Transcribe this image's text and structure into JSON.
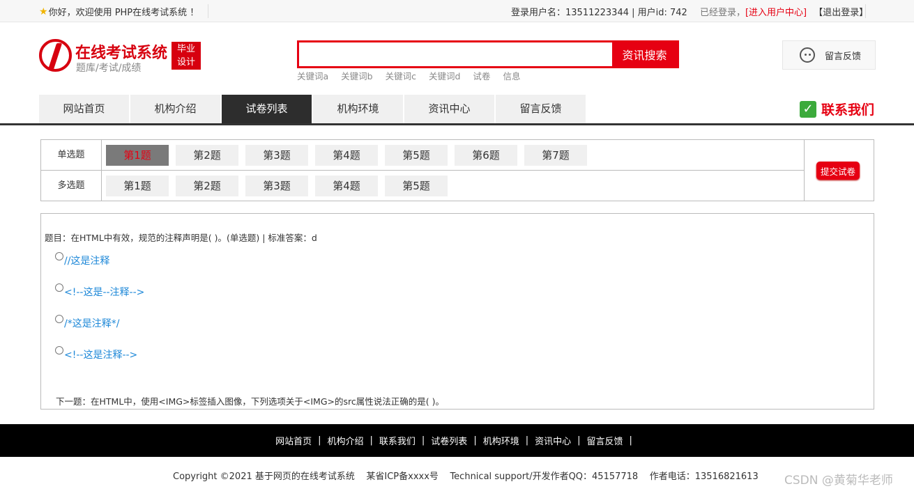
{
  "topbar": {
    "welcome": "你好，欢迎使用 PHP在线考试系统 ！",
    "user_label": "登录用户名：13511223344 | 用户id: 742",
    "status": "已经登录，",
    "user_center": "[进入用户中心]",
    "logout": "【退出登录】"
  },
  "logo": {
    "title": "在线考试系统",
    "subtitle": "题库/考试/成绩",
    "badge_line1": "毕业",
    "badge_line2": "设计"
  },
  "search": {
    "value": "",
    "button": "资讯搜索",
    "keywords": [
      "关键词a",
      "关键词b",
      "关键词c",
      "关键词d",
      "试卷",
      "信息"
    ]
  },
  "feedback_box": {
    "label": "留言反馈"
  },
  "nav": {
    "items": [
      "网站首页",
      "机构介绍",
      "试卷列表",
      "机构环境",
      "资讯中心",
      "留言反馈"
    ],
    "active_index": 2
  },
  "contact": {
    "label": "联系我们"
  },
  "question_nav": {
    "single_label": "单选题",
    "single_items": [
      "第1题",
      "第2题",
      "第3题",
      "第4题",
      "第5题",
      "第6题",
      "第7题"
    ],
    "multi_label": "多选题",
    "multi_items": [
      "第1题",
      "第2题",
      "第3题",
      "第4题",
      "第5题"
    ],
    "active": "single-1",
    "submit": "提交试卷"
  },
  "question": {
    "text": "题目：在HTML中有效，规范的注释声明是( )。(单选题) | 标准答案：d",
    "options": [
      "//这是注释",
      "<!--这是--注释-->",
      "/*这是注释*/",
      "<!--这是注释-->"
    ],
    "next": "下一题：在HTML中，使用<IMG>标签插入图像，下列选项关于<IMG>的src属性说法正确的是( )。"
  },
  "footer": {
    "links": [
      "网站首页",
      "机构介绍",
      "联系我们",
      "试卷列表",
      "机构环境",
      "资讯中心",
      "留言反馈"
    ],
    "copyright": "Copyright ©2021 基于网页的在线考试系统    某省ICP备xxxx号    Technical support/开发作者QQ：45157718    作者电话：13516821613",
    "watermark": "CSDN @黄菊华老师"
  },
  "colors": {
    "accent": "#e60012",
    "nav_active": "#2d2d2d",
    "link": "#1e88d8"
  }
}
